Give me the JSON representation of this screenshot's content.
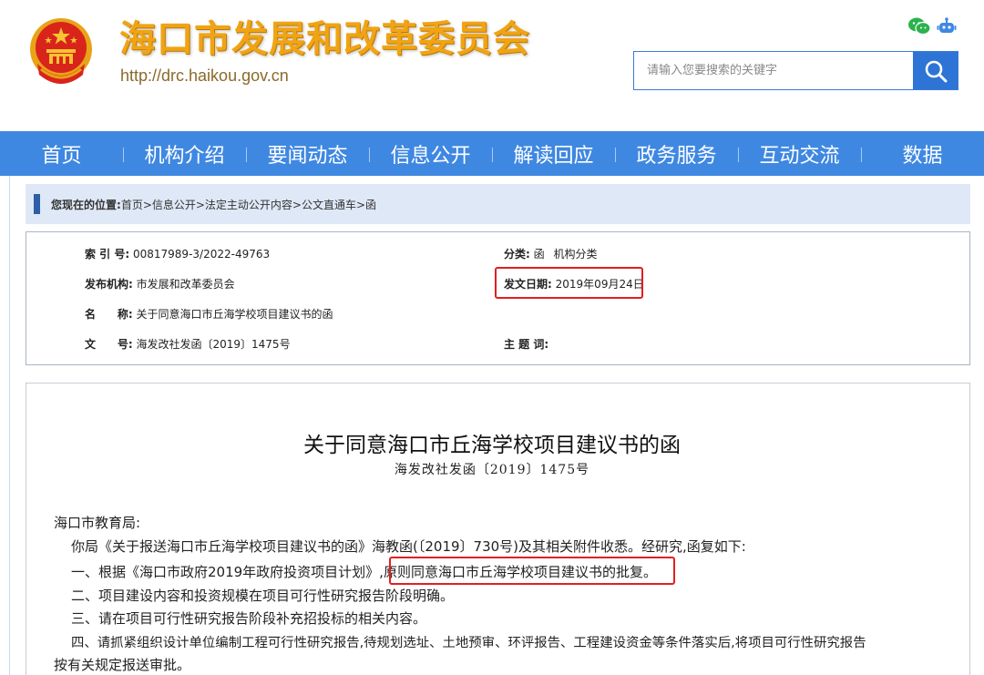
{
  "header": {
    "title": "海口市发展和改革委员会",
    "url": "http://drc.haikou.gov.cn",
    "social_icons": [
      "wechat-icon",
      "robot-icon"
    ],
    "search": {
      "placeholder": "请输入您要搜索的关键字",
      "button_icon": "search-icon"
    }
  },
  "nav": {
    "items": [
      "首页",
      "机构介绍",
      "要闻动态",
      "信息公开",
      "解读回应",
      "政务服务",
      "互动交流",
      "数据"
    ]
  },
  "breadcrumb": {
    "label": "您现在的位置:",
    "path": "首页>信息公开>法定主动公开内容>公文直通车>函"
  },
  "info": {
    "index_label": "索 引 号:",
    "index_value": "00817989-3/2022-49763",
    "category_label": "分类:",
    "category_value": "函",
    "category_extra": "机构分类",
    "publisher_label": "发布机构:",
    "publisher_value": "市发展和改革委员会",
    "date_label": "发文日期:",
    "date_value": "2019年09月24日",
    "name_label_1": "名",
    "name_label_2": "称:",
    "name_value": "关于同意海口市丘海学校项目建议书的函",
    "docno_label_1": "文",
    "docno_label_2": "号:",
    "docno_value": "海发改社发函〔2019〕1475号",
    "subject_label": "主 题 词:"
  },
  "document": {
    "title": "关于同意海口市丘海学校项目建议书的函",
    "number": "海发改社发函〔2019〕1475号",
    "salutation": "海口市教育局:",
    "p1": "你局《关于报送海口市丘海学校项目建议书的函》海教函(〔2019〕730号)及其相关附件收悉。经研究,函复如下:",
    "p2a": "一、根据《海口市政府2019年政府投资项目计划》,",
    "p2b": "原则同意海口市丘海学校项目建议书的批复。",
    "p3": "二、项目建设内容和投资规模在项目可行性研究报告阶段明确。",
    "p4": "三、请在项目可行性研究报告阶段补充招投标的相关内容。",
    "p5": "四、请抓紧组织设计单位编制工程可行性研究报告,待规划选址、土地预审、环评报告、工程建设资金等条件落实后,将项目可行性研究报告",
    "p6": "按有关规定报送审批。"
  },
  "colors": {
    "nav_bg": "#3f88e2",
    "title_gold": "#f0a414",
    "highlight_red": "#e02020",
    "breadcrumb_bg": "#dfe8f6"
  }
}
